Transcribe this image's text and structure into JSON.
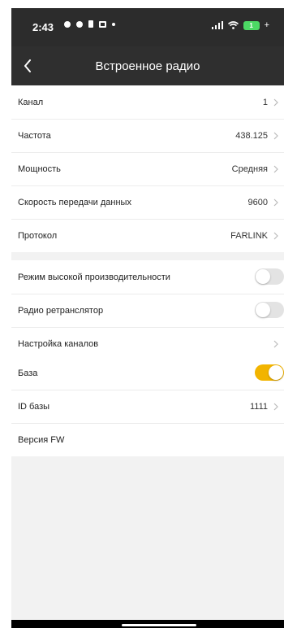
{
  "status_bar": {
    "time": "2:43",
    "battery_level": "1",
    "icons": [
      "chat-bubble-icon",
      "chat-bubble-icon",
      "sim-icon",
      "mail-icon",
      "dot-icon",
      "signal-icon",
      "wifi-icon",
      "battery-icon"
    ]
  },
  "header": {
    "title": "Встроенное радио",
    "back_icon": "chevron-left-icon"
  },
  "group1": [
    {
      "label": "Канал",
      "value": "1"
    },
    {
      "label": "Частота",
      "value": "438.125"
    },
    {
      "label": "Мощность",
      "value": "Средняя"
    },
    {
      "label": "Скорость передачи данных",
      "value": "9600"
    },
    {
      "label": "Протокол",
      "value": "FARLINK"
    }
  ],
  "group2": [
    {
      "label": "Режим высокой производительности",
      "toggle": "off"
    },
    {
      "label": "Радио ретранслятор",
      "toggle": "off"
    },
    {
      "label": "Настройка каналов"
    }
  ],
  "group3": [
    {
      "label": "База",
      "toggle": "on"
    },
    {
      "label": "ID базы",
      "value": "1111"
    },
    {
      "label": "Версия FW"
    }
  ],
  "colors": {
    "accent": "#f2b400",
    "header_bg": "#2f2f2f",
    "page_bg": "#f2f2f2"
  }
}
